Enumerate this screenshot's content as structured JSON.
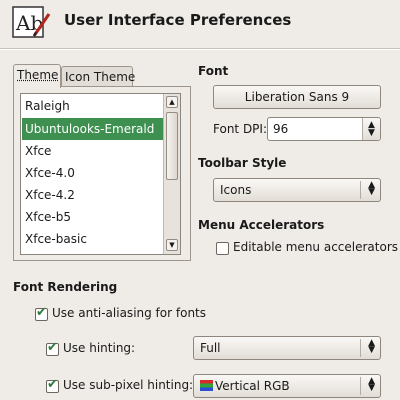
{
  "window": {
    "title": "User Interface Preferences"
  },
  "tabs": [
    {
      "label": "Theme",
      "active": true
    },
    {
      "label": "Icon Theme",
      "active": false
    }
  ],
  "theme_list": {
    "items": [
      "Raleigh",
      "Ubuntulooks-Emerald",
      "Xfce",
      "Xfce-4.0",
      "Xfce-4.2",
      "Xfce-b5",
      "Xfce-basic"
    ],
    "selected": "Ubuntulooks-Emerald",
    "selection_color": "#3e9050"
  },
  "font": {
    "section_label": "Font",
    "button_label": "Liberation Sans 9",
    "dpi_label": "Font DPI:",
    "dpi_value": "96"
  },
  "toolbar_style": {
    "section_label": "Toolbar Style",
    "value": "Icons"
  },
  "menu_accelerators": {
    "section_label": "Menu Accelerators",
    "editable_label": "Editable menu accelerators",
    "editable_checked": false
  },
  "font_rendering": {
    "section_label": "Font Rendering",
    "antialias_label": "Use anti-aliasing for fonts",
    "antialias_checked": true,
    "hinting_label": "Use hinting:",
    "hinting_checked": true,
    "hinting_value": "Full",
    "subpixel_label": "Use sub-pixel hinting:",
    "subpixel_checked": true,
    "subpixel_value": "Vertical RGB"
  },
  "icons": {
    "app": "appearance-settings-icon",
    "scroll_up": "arrow-up-icon",
    "scroll_down": "arrow-down-icon",
    "combo": "updown-arrows-icon",
    "check": "checkmark-icon",
    "subpixel": "rgb-swatch-icon"
  }
}
